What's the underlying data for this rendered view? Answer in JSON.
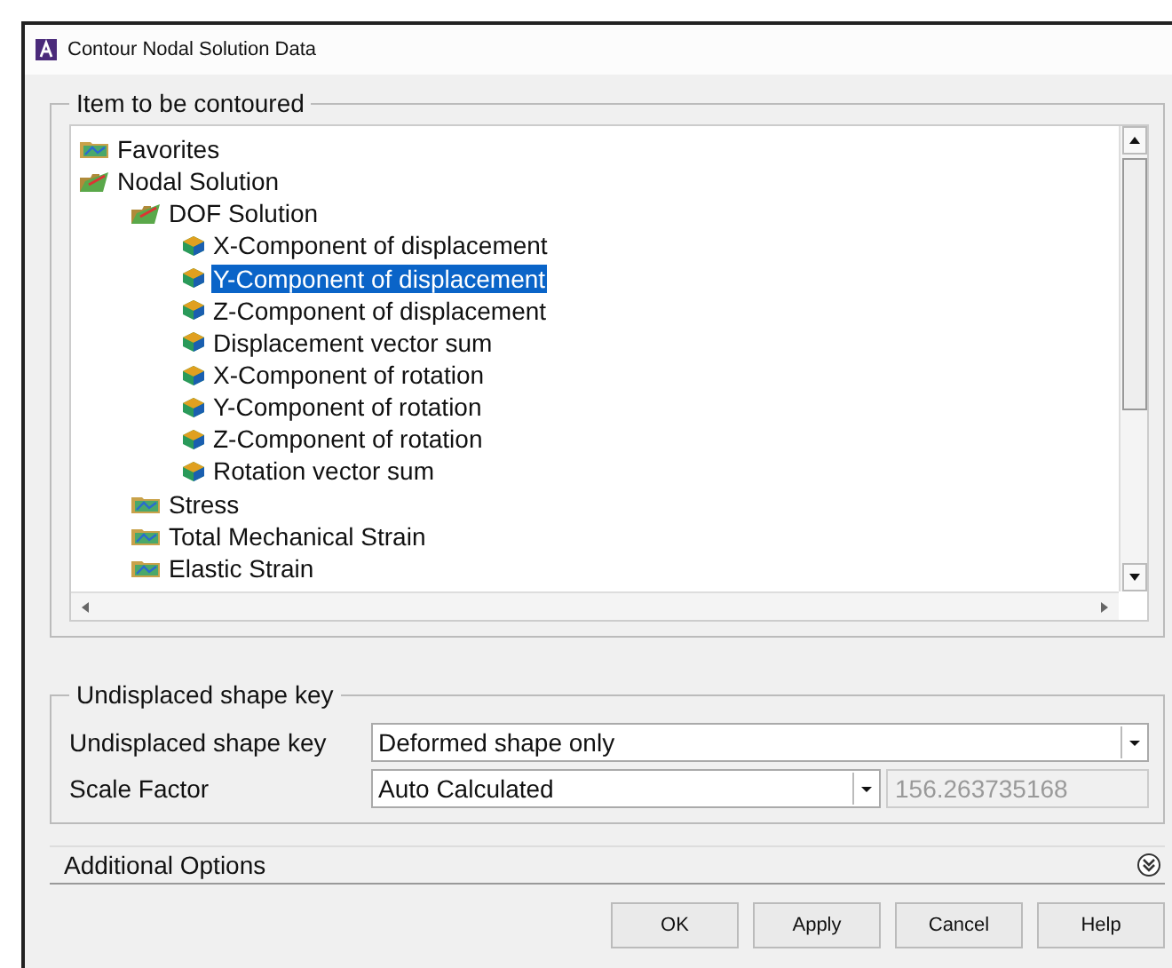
{
  "window": {
    "title": "Contour Nodal Solution Data"
  },
  "item_group": {
    "legend": "Item to be contoured",
    "tree": [
      {
        "label": "Favorites",
        "kind": "folder",
        "selected": false
      },
      {
        "label": "Nodal Solution",
        "kind": "open-folder",
        "selected": false,
        "children": [
          {
            "label": "DOF Solution",
            "kind": "open-folder",
            "selected": false,
            "children": [
              {
                "label": "X-Component of displacement",
                "kind": "result",
                "selected": false
              },
              {
                "label": "Y-Component of displacement",
                "kind": "result",
                "selected": true
              },
              {
                "label": "Z-Component of displacement",
                "kind": "result",
                "selected": false
              },
              {
                "label": "Displacement vector sum",
                "kind": "result",
                "selected": false
              },
              {
                "label": "X-Component of rotation",
                "kind": "result",
                "selected": false
              },
              {
                "label": "Y-Component of rotation",
                "kind": "result",
                "selected": false
              },
              {
                "label": "Z-Component of rotation",
                "kind": "result",
                "selected": false
              },
              {
                "label": "Rotation vector sum",
                "kind": "result",
                "selected": false
              }
            ]
          },
          {
            "label": "Stress",
            "kind": "folder",
            "selected": false
          },
          {
            "label": "Total Mechanical Strain",
            "kind": "folder",
            "selected": false
          },
          {
            "label": "Elastic Strain",
            "kind": "folder",
            "selected": false
          }
        ]
      }
    ]
  },
  "shape_group": {
    "legend": "Undisplaced shape key",
    "fields": [
      {
        "label": "Undisplaced shape key",
        "value": "Deformed shape only"
      },
      {
        "label": "Scale Factor",
        "value": "Auto Calculated",
        "extra": "156.263735168",
        "extra_disabled": true
      }
    ]
  },
  "additional_options": {
    "label": "Additional Options",
    "expanded": false
  },
  "buttons": [
    "OK",
    "Apply",
    "Cancel",
    "Help"
  ]
}
